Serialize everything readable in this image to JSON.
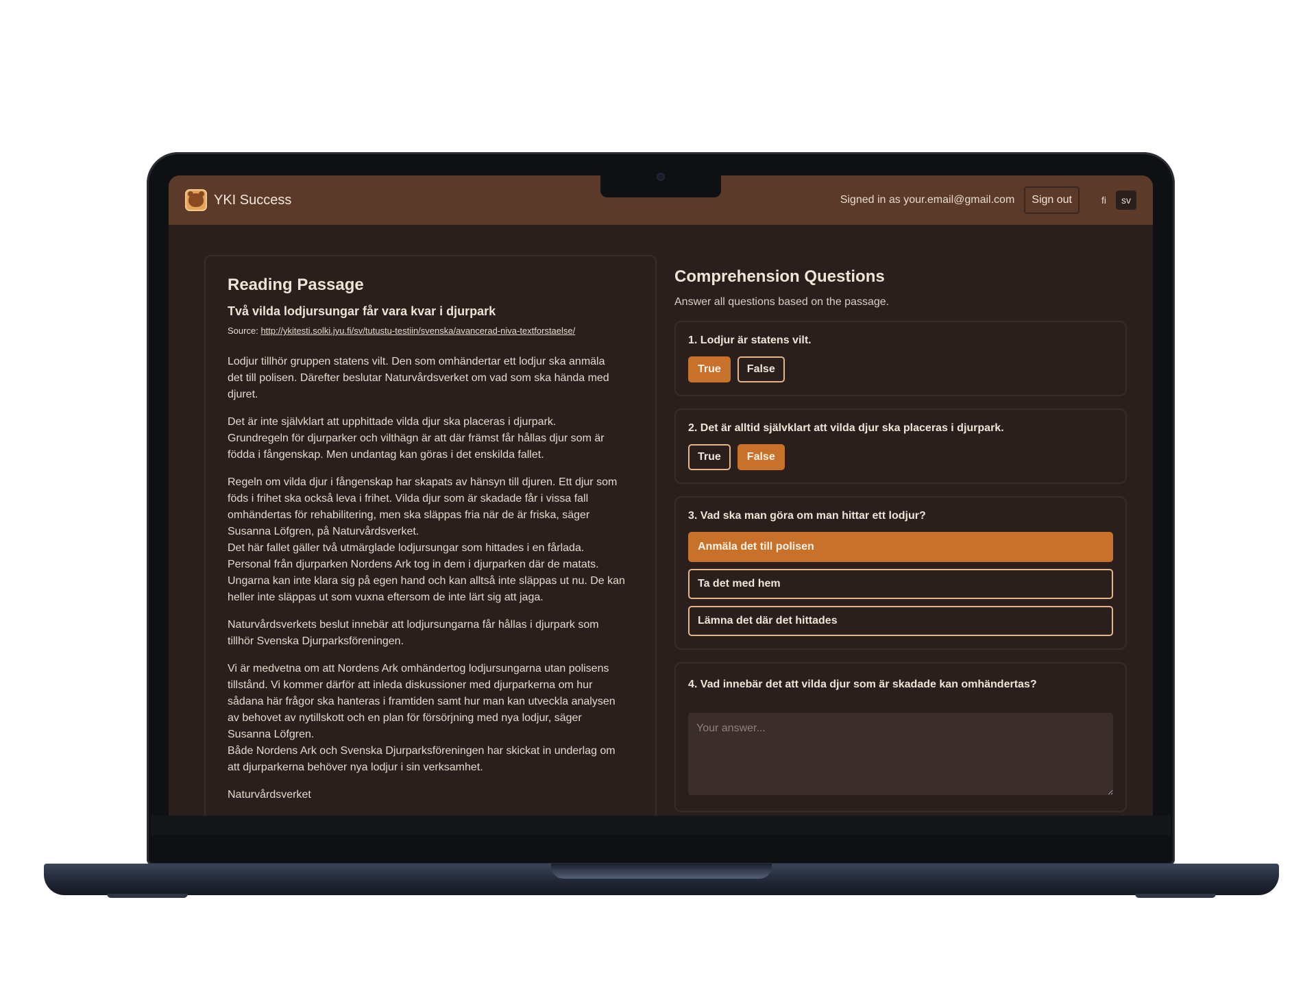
{
  "header": {
    "app_title": "YKI Success",
    "signed_in_text": "Signed in as your.email@gmail.com",
    "signout_label": "Sign out",
    "languages": [
      "fi",
      "sv"
    ],
    "active_language": "sv"
  },
  "passage": {
    "heading": "Reading Passage",
    "title": "Två vilda lodjursungar får vara kvar i djurpark",
    "source_label": "Source:",
    "source_url": "http://ykitesti.solki.jyu.fi/sv/tutustu-testiin/svenska/avancerad-niva-textforstaelse/",
    "paragraphs": [
      [
        "Lodjur tillhör gruppen statens vilt. Den som omhändertar ett lodjur ska anmäla",
        "det till polisen. Därefter beslutar Naturvårdsverket om vad som ska hända med",
        "djuret."
      ],
      [
        "Det är inte självklart att upphittade vilda djur ska placeras i djurpark.",
        "Grundregeln för djurparker och vilthägn är att där främst får hållas djur som är",
        "födda i fångenskap. Men undantag kan göras i det enskilda fallet."
      ],
      [
        "Regeln om vilda djur i fångenskap har skapats av hänsyn till djuren. Ett djur som",
        "föds i frihet ska också leva i frihet. Vilda djur som är skadade får i vissa fall",
        "omhändertas för rehabilitering, men ska släppas fria när de är friska, säger",
        "Susanna Löfgren, på Naturvårdsverket.",
        "Det här fallet gäller två utmärglade lodjursungar som hittades i en fårlada.",
        "Personal från djurparken Nordens Ark tog in dem i djurparken där de matats.",
        "Ungarna kan inte klara sig på egen hand och kan alltså inte släppas ut nu. De kan",
        "heller inte släppas ut som vuxna eftersom de inte lärt sig att jaga."
      ],
      [
        "Naturvårdsverkets beslut innebär att lodjursungarna får hållas i djurpark som",
        "tillhör Svenska Djurparksföreningen."
      ],
      [
        "Vi är medvetna om att Nordens Ark omhändertog lodjursungarna utan polisens",
        "tillstånd. Vi kommer därför att inleda diskussioner med djurparkerna om hur",
        "sådana här frågor ska hanteras i framtiden samt hur man kan utveckla analysen",
        "av behovet av nytillskott och en plan för försörjning med nya lodjur, säger",
        "Susanna Löfgren.",
        "Både Nordens Ark och Svenska Djurparksföreningen har skickat in underlag om",
        "att djurparkerna behöver nya lodjur i sin verksamhet."
      ],
      [
        "Naturvårdsverket"
      ]
    ]
  },
  "questions": {
    "heading": "Comprehension Questions",
    "subtitle": "Answer all questions based on the passage.",
    "q1": {
      "text": "1. Lodjur är statens vilt.",
      "true_label": "True",
      "false_label": "False",
      "selected": "True"
    },
    "q2": {
      "text": "2. Det är alltid självklart att vilda djur ska placeras i djurpark.",
      "true_label": "True",
      "false_label": "False",
      "selected": "False"
    },
    "q3": {
      "text": "3. Vad ska man göra om man hittar ett lodjur?",
      "options": [
        "Anmäla det till polisen",
        "Ta det med hem",
        "Lämna det där det hittades"
      ],
      "selected": "Anmäla det till polisen"
    },
    "q4": {
      "text": "4. Vad innebär det att vilda djur som är skadade kan omhändertas?",
      "placeholder": "Your answer...",
      "value": ""
    }
  },
  "colors": {
    "header_bg": "#5c3a2a",
    "page_bg": "#2b1f1d",
    "accent": "#c8712a",
    "outline": "#e8b48a"
  }
}
